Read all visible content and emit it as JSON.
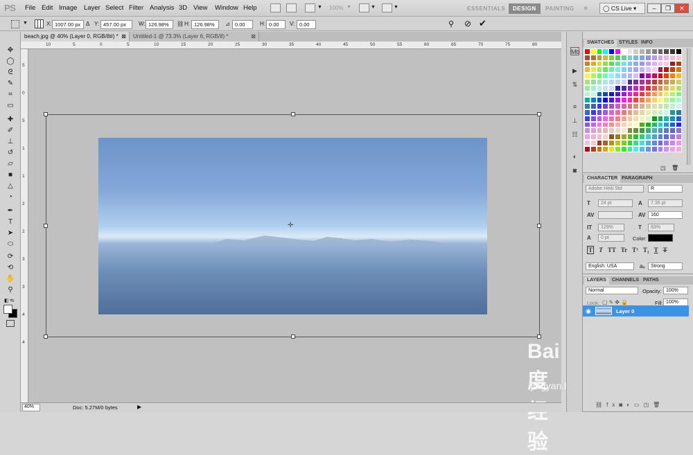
{
  "app": {
    "logo": "PS"
  },
  "menu": [
    "File",
    "Edit",
    "Image",
    "Layer",
    "Select",
    "Filter",
    "Analysis",
    "3D",
    "View",
    "Window",
    "Help"
  ],
  "toolbar": {
    "zoom": "100%"
  },
  "workspaces": {
    "essentials": "ESSENTIALS",
    "design": "DESIGN",
    "painting": "PAINTING",
    "more": "»"
  },
  "cslive": "CS Live",
  "options": {
    "x_label": "X:",
    "x_value": "1007.00 px",
    "y_label": "Y:",
    "y_value": "457.00 px",
    "w_label": "W:",
    "w_value": "126.98%",
    "h_label": "H:",
    "h_value": "126.98%",
    "angle_value": "0.00",
    "hskew_label": "H:",
    "hskew_value": "0.00",
    "vskew_label": "V:",
    "vskew_value": "0.00"
  },
  "tabs": [
    {
      "label": "beach.jpg @ 40% (Layer 0, RGB/8#) *"
    },
    {
      "label": "Untitled-1 @ 73.3% (Layer 6, RGB/8) *"
    }
  ],
  "ruler_h": [
    "10",
    "5",
    "0",
    "5",
    "10",
    "15",
    "20",
    "25",
    "30",
    "35",
    "40",
    "45",
    "50",
    "55",
    "60",
    "65",
    "70",
    "75",
    "80"
  ],
  "ruler_v": [
    "5",
    "0",
    "5",
    "1",
    "1",
    "2",
    "2",
    "3",
    "3",
    "4",
    "4"
  ],
  "status": {
    "zoom": "40%",
    "doc": "Doc: 5.27M/0 bytes"
  },
  "swatches_panel": {
    "tabs": [
      "SWATCHES",
      "STYLES",
      "INFO"
    ]
  },
  "character_panel": {
    "tabs": [
      "CHARACTER",
      "PARAGRAPH"
    ],
    "font_family": "Adobe Heiti Std",
    "font_style": "R",
    "font_size": "24 pt",
    "leading": "7.35 pt",
    "tracking": "160",
    "vscale": "129%",
    "hscale": "93%",
    "baseline": "0 pt",
    "color_label": "Color:",
    "language": "English: USA",
    "aa_label": "aₐ",
    "antialias": "Strong",
    "type_buttons": [
      "T",
      "T",
      "TT",
      "Tr",
      "T¹",
      "T₁",
      "T",
      "T"
    ]
  },
  "layers_panel": {
    "tabs": [
      "LAYERS",
      "CHANNELS",
      "PATHS"
    ],
    "blend_mode": "Normal",
    "opacity_label": "Opacity:",
    "opacity": "100%",
    "lock_label": "Lock:",
    "fill_label": "Fill:",
    "fill": "100%",
    "layer_name": "Layer 0"
  },
  "watermark": {
    "text": "Bai度经验",
    "url": "jingyan.baidu.com"
  },
  "swatch_colors": [
    "#ff0000",
    "#ffff00",
    "#00ff00",
    "#00ffff",
    "#0000ff",
    "#ff00ff",
    "#ffffff",
    "#e6e6e6",
    "#cccccc",
    "#b3b3b3",
    "#999999",
    "#808080",
    "#666666",
    "#4d4d4d",
    "#333333",
    "#000000"
  ]
}
